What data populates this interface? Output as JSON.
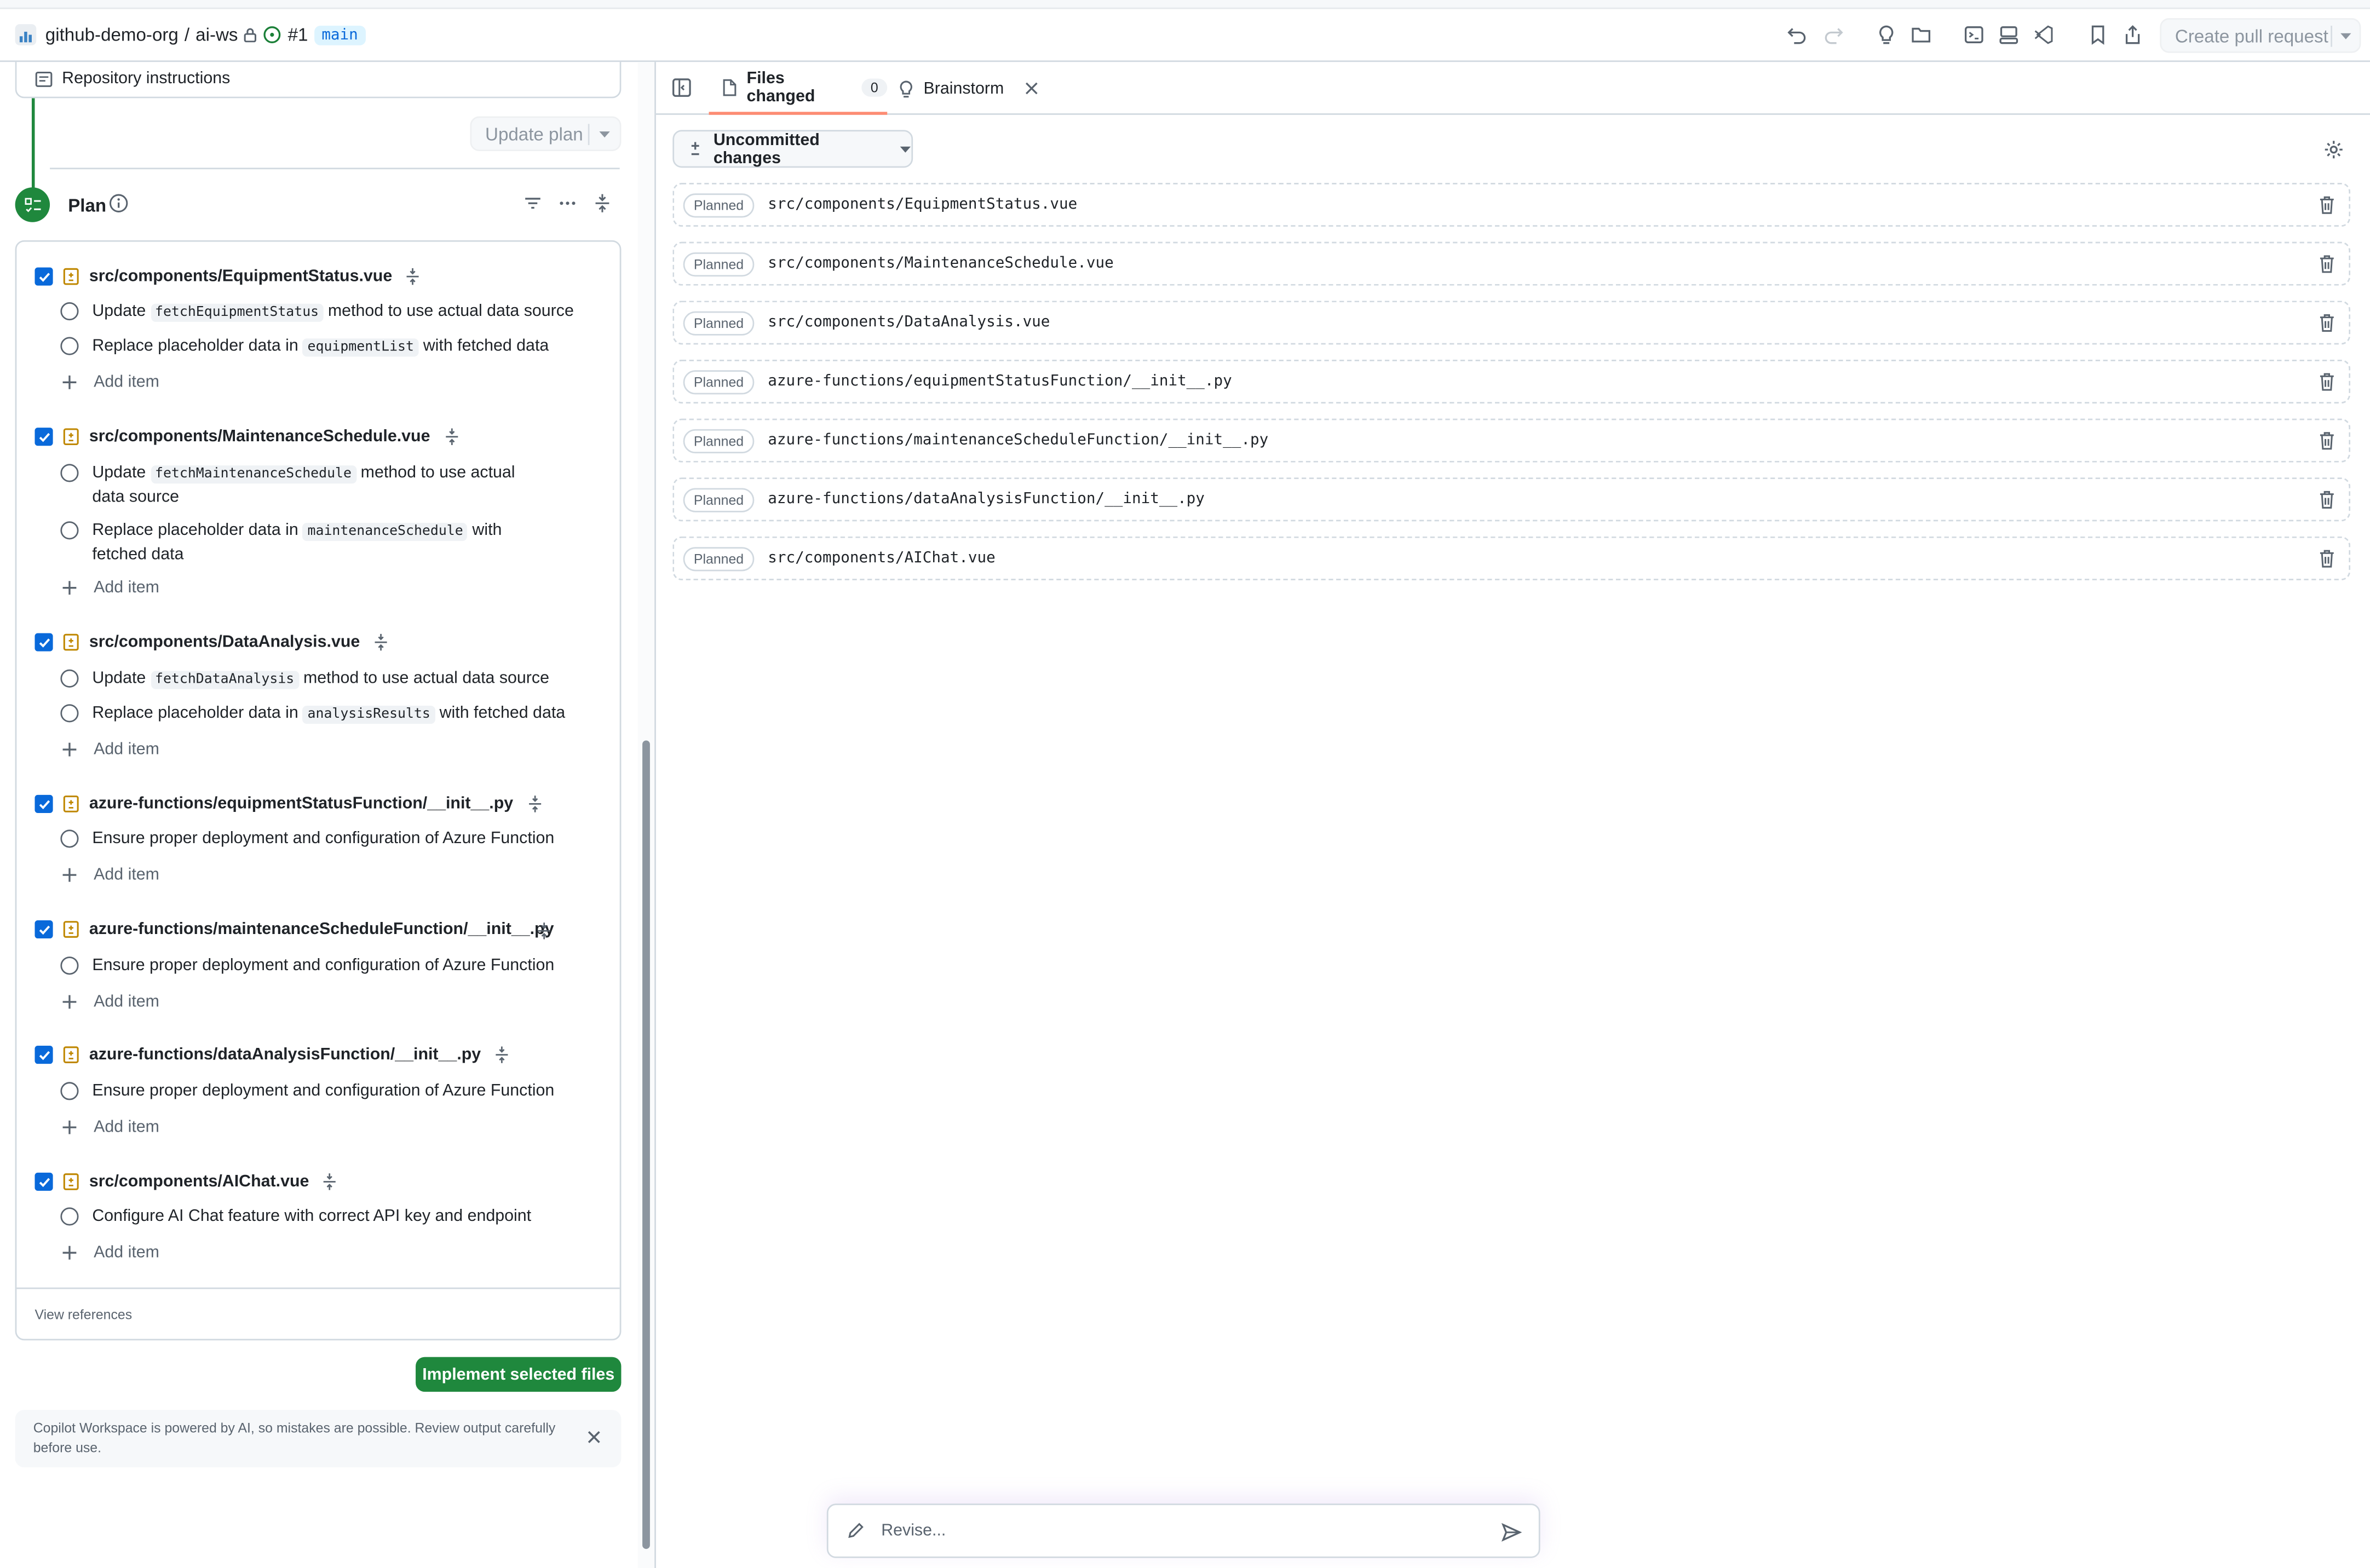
{
  "header": {
    "org": "github-demo-org",
    "separator": "/",
    "repo": "ai-ws",
    "issue": "#1",
    "branch": "main",
    "create_pr_label": "Create pull request"
  },
  "left": {
    "repo_instructions": "Repository instructions",
    "update_plan_label": "Update plan",
    "plan_title": "Plan",
    "files": [
      {
        "path": "src/components/EquipmentStatus.vue",
        "checked": true,
        "tasks": [
          {
            "pre": "Update ",
            "code": "fetchEquipmentStatus",
            "post": " method to use actual data source"
          },
          {
            "pre": "Replace placeholder data in ",
            "code": "equipmentList",
            "post": " with fetched data"
          }
        ]
      },
      {
        "path": "src/components/MaintenanceSchedule.vue",
        "checked": true,
        "tasks": [
          {
            "pre": "Update ",
            "code": "fetchMaintenanceSchedule",
            "post": " method to use actual data source"
          },
          {
            "pre": "Replace placeholder data in ",
            "code": "maintenanceSchedule",
            "post": " with fetched data"
          }
        ]
      },
      {
        "path": "src/components/DataAnalysis.vue",
        "checked": true,
        "tasks": [
          {
            "pre": "Update ",
            "code": "fetchDataAnalysis",
            "post": " method to use actual data source"
          },
          {
            "pre": "Replace placeholder data in ",
            "code": "analysisResults",
            "post": " with fetched data"
          }
        ]
      },
      {
        "path": "azure-functions/equipmentStatusFunction/__init__.py",
        "checked": true,
        "tasks": [
          {
            "pre": "Ensure proper deployment and configuration of Azure Function",
            "code": "",
            "post": ""
          }
        ]
      },
      {
        "path": "azure-functions/maintenanceScheduleFunction/__init__.py",
        "checked": true,
        "tasks": [
          {
            "pre": "Ensure proper deployment and configuration of Azure Function",
            "code": "",
            "post": ""
          }
        ]
      },
      {
        "path": "azure-functions/dataAnalysisFunction/__init__.py",
        "checked": true,
        "tasks": [
          {
            "pre": "Ensure proper deployment and configuration of Azure Function",
            "code": "",
            "post": ""
          }
        ]
      },
      {
        "path": "src/components/AIChat.vue",
        "checked": true,
        "tasks": [
          {
            "pre": "Configure AI Chat feature with correct API key and endpoint",
            "code": "",
            "post": ""
          }
        ]
      }
    ],
    "add_item_label": "Add item",
    "view_references": "View references",
    "implement_label": "Implement selected files",
    "notice": "Copilot Workspace is powered by AI, so mistakes are possible. Review output carefully before use."
  },
  "right": {
    "tab_files": "Files changed",
    "tab_files_count": "0",
    "tab_brainstorm": "Brainstorm",
    "uncommitted_label": "Uncommitted changes",
    "status_label": "Planned",
    "changed_files": [
      "src/components/EquipmentStatus.vue",
      "src/components/MaintenanceSchedule.vue",
      "src/components/DataAnalysis.vue",
      "azure-functions/equipmentStatusFunction/__init__.py",
      "azure-functions/maintenanceScheduleFunction/__init__.py",
      "azure-functions/dataAnalysisFunction/__init__.py",
      "src/components/AIChat.vue"
    ],
    "revise_placeholder": "Revise..."
  },
  "colors": {
    "accent_green": "#1f883d",
    "checkbox_blue": "#0969da",
    "file_icon": "#bf8700",
    "tab_underline": "#fd8c73"
  }
}
